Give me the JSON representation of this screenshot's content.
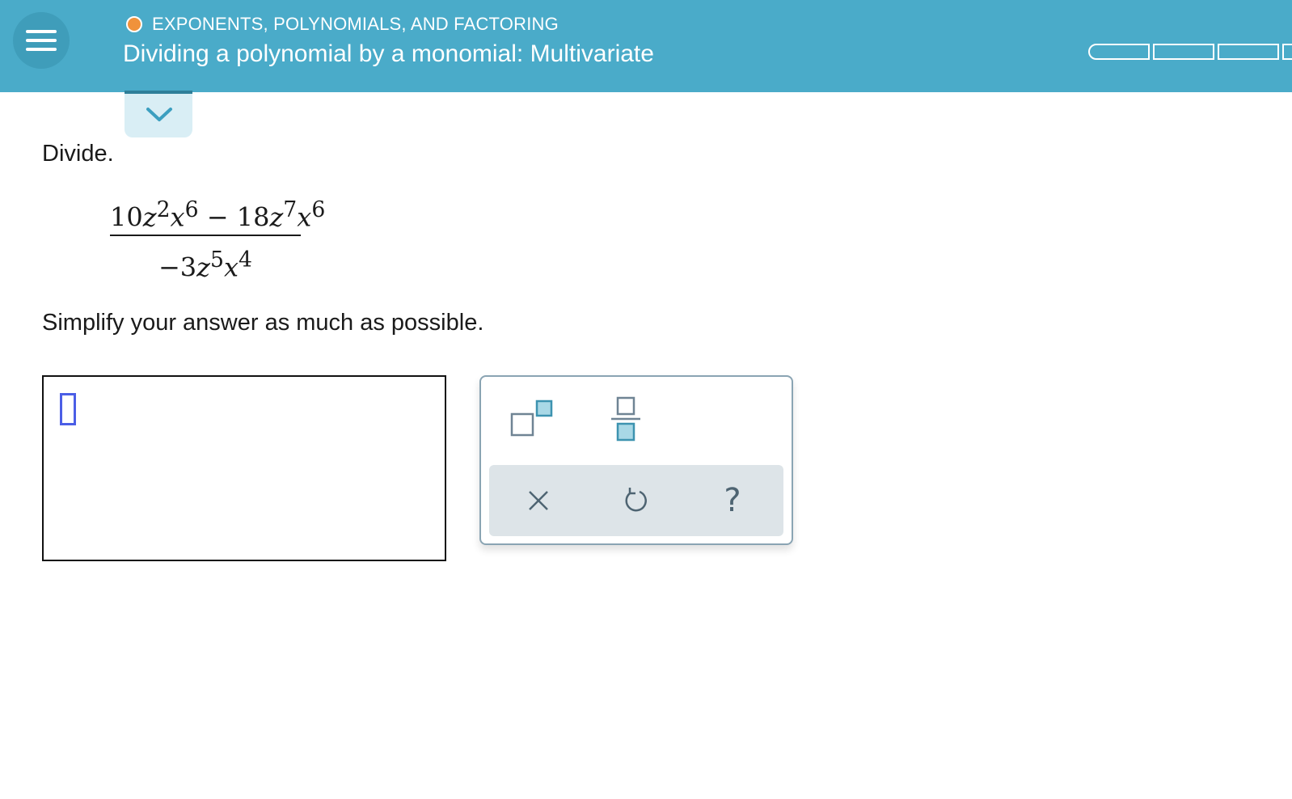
{
  "header": {
    "topic": "EXPONENTS, POLYNOMIALS, AND FACTORING",
    "title": "Dividing a polynomial by a monomial: Multivariate",
    "menu_icon": "hamburger-menu-icon",
    "topic_status_color": "#f0923b",
    "background_color": "#4aabc9",
    "progress_segments": 4
  },
  "question": {
    "prompt": "Divide.",
    "numerator": {
      "term1": {
        "coef": "10",
        "z_exp": "2",
        "x_exp": "6"
      },
      "operator": "−",
      "term2": {
        "coef": "18",
        "z_exp": "7",
        "x_exp": "6"
      }
    },
    "denominator": {
      "coef": "−3",
      "z_exp": "5",
      "x_exp": "4"
    },
    "variables": {
      "z": "z",
      "x": "x"
    },
    "instructions": "Simplify your answer as much as possible."
  },
  "answer": {
    "value": ""
  },
  "keypad": {
    "buttons": [
      "exponent-icon",
      "fraction-icon"
    ],
    "actions": [
      "clear-icon",
      "undo-icon",
      "help-icon"
    ],
    "help_label": "?"
  }
}
